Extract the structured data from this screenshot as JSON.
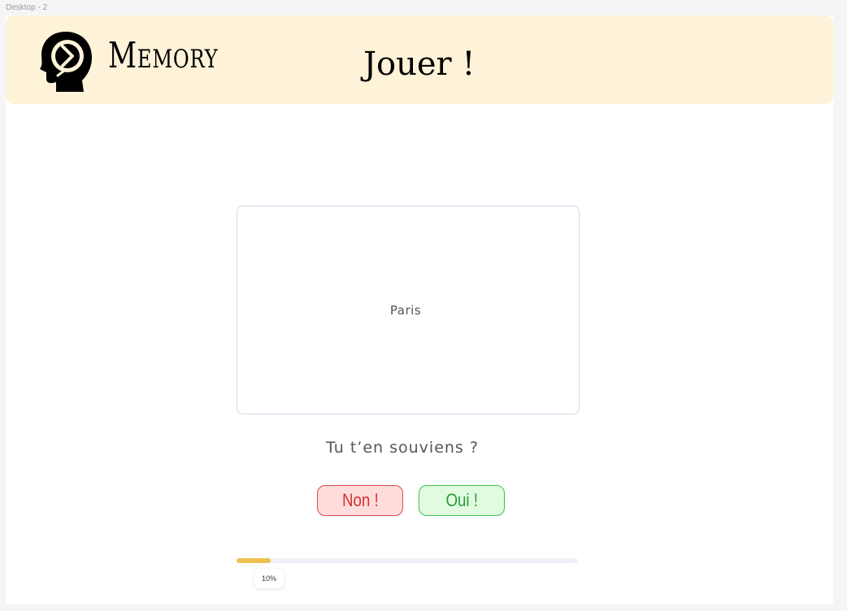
{
  "canvas": {
    "frame_label": "Desktop - 2"
  },
  "header": {
    "logo_icon": "head-with-arrows-icon",
    "brand": "Memory",
    "nav_title": "Jouer !"
  },
  "card": {
    "word": "Paris"
  },
  "prompt": {
    "question": "Tu t’en souviens ?"
  },
  "actions": {
    "no_label": "Non !",
    "yes_label": "Oui !"
  },
  "progress": {
    "value_percent": 10,
    "label": "10%"
  },
  "colors": {
    "header_bg": "#fef3d8",
    "no_bg": "#fedcdc",
    "no_border": "#e24b4b",
    "yes_bg": "#e1fbe1",
    "yes_border": "#3cbf52",
    "progress_fill": "#edc14f"
  }
}
